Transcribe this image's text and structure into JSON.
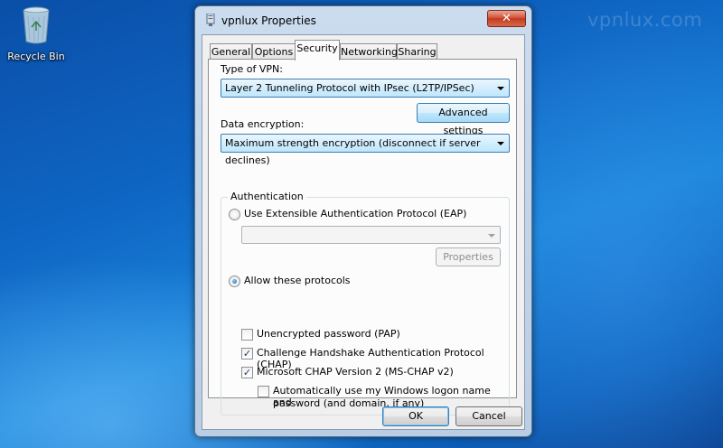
{
  "watermark": "vpnlux.com",
  "desktop": {
    "recycle_bin_label": "Recycle Bin"
  },
  "window": {
    "title": "vpnlux Properties",
    "close_glyph": "✕"
  },
  "tabs": [
    {
      "label": "General"
    },
    {
      "label": "Options"
    },
    {
      "label": "Security",
      "active": true
    },
    {
      "label": "Networking"
    },
    {
      "label": "Sharing"
    }
  ],
  "security": {
    "vpn_type_label": "Type of VPN:",
    "vpn_type_value": "Layer 2 Tunneling Protocol with IPsec (L2TP/IPSec)",
    "advanced_button": "Advanced settings",
    "encryption_label": "Data encryption:",
    "encryption_value": "Maximum strength encryption (disconnect if server declines)",
    "auth": {
      "group_title": "Authentication",
      "eap_label": "Use Extensible Authentication Protocol (EAP)",
      "eap_selected": false,
      "eap_dropdown_value": "",
      "properties_button": "Properties",
      "allow_label": "Allow these protocols",
      "allow_selected": true,
      "protocols": [
        {
          "label": "Unencrypted password (PAP)",
          "checked": false
        },
        {
          "label": "Challenge Handshake Authentication Protocol (CHAP)",
          "checked": true
        },
        {
          "label": "Microsoft CHAP Version 2 (MS-CHAP v2)",
          "checked": true
        }
      ],
      "auto_logon_line1": "Automatically use my Windows logon name and",
      "auto_logon_line2": "password (and domain, if any)",
      "auto_logon_checked": false
    }
  },
  "footer": {
    "ok": "OK",
    "cancel": "Cancel"
  },
  "colors": {
    "desktop_blue": "#0f66c4",
    "focus_border": "#3c7fb1",
    "close_red": "#c33b1f"
  }
}
